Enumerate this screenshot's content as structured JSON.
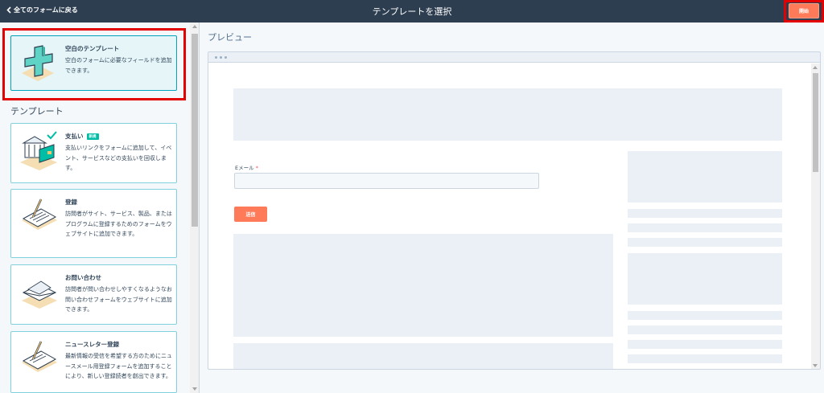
{
  "topbar": {
    "back_label": "全てのフォームに戻る",
    "title": "テンプレートを選択",
    "start_label": "開始"
  },
  "sidebar": {
    "blank_card": {
      "title": "空白のテンプレート",
      "description": "空白のフォームに必要なフィールドを追加できます。"
    },
    "section_heading": "テンプレート",
    "templates": [
      {
        "title": "支払い",
        "badge": "新規",
        "description": "支払いリンクをフォームに追加して、イベント、サービスなどの支払いを回収します。",
        "icon": "bank-payment-icon"
      },
      {
        "title": "登録",
        "description": "訪問者がサイト、サービス、製品、またはプログラムに登録するためのフォームをウェブサイトに追加できます。",
        "icon": "registration-form-icon"
      },
      {
        "title": "お問い合わせ",
        "description": "訪問者が問い合わせしやすくなるようなお問い合わせフォームをウェブサイトに追加できます。",
        "icon": "envelope-icon"
      },
      {
        "title": "ニュースレター登録",
        "description": "最新情報の受信を希望する方のためにニュースメール用登録フォームを追加することにより、新しい登録読者を創出できます。",
        "icon": "newsletter-form-icon"
      }
    ]
  },
  "preview": {
    "heading": "プレビュー",
    "email_label": "Eメール",
    "required_mark": "*",
    "submit_label": "送信"
  },
  "colors": {
    "topbar": "#2d3e50",
    "accent": "#ff7a59",
    "teal": "#00a4bd",
    "highlight": "#e30000"
  }
}
